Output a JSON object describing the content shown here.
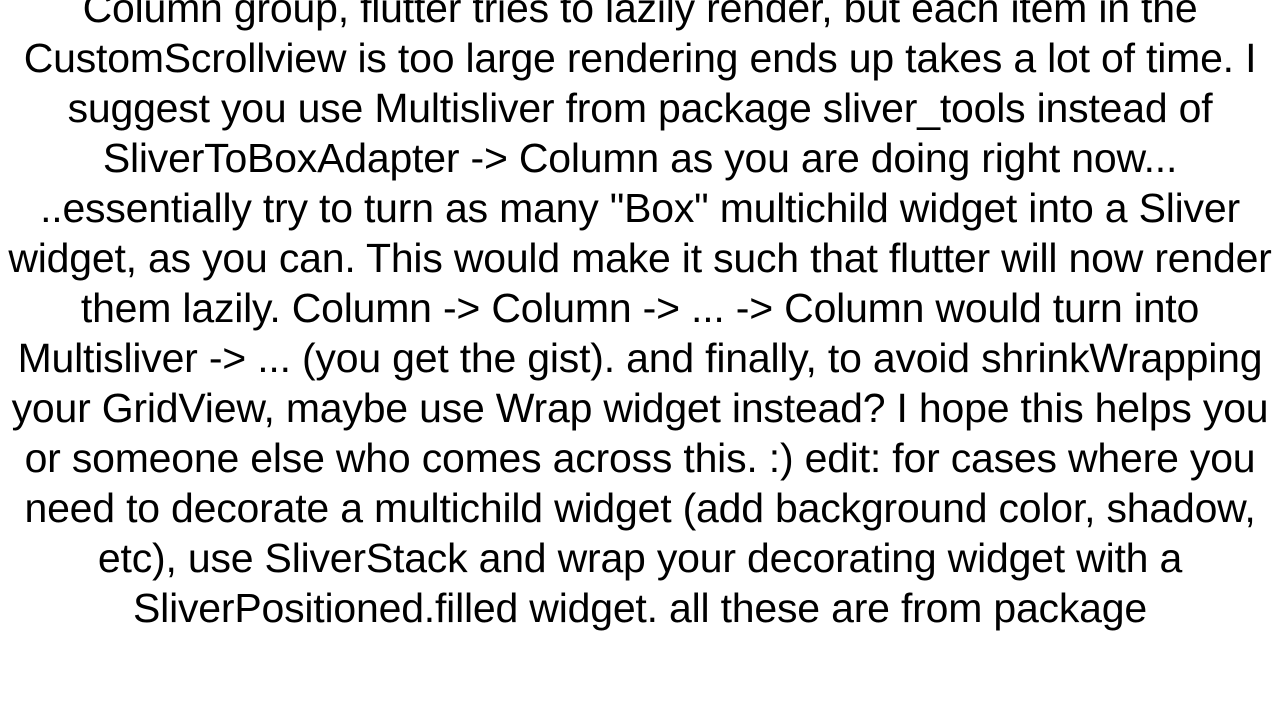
{
  "content": {
    "body_text": "Column group, flutter tries to lazily render, but each item in the CustomScrollview is too large rendering ends up takes a lot of time. I suggest you use Multisliver from package sliver_tools instead of SliverToBoxAdapter -> Column as you are doing right now... ..essentially try to turn as many \"Box\" multichild widget into a Sliver widget, as you can. This would make it such that flutter will now render them lazily. Column -> Column -> ... -> Column would turn into Multisliver -> ... (you get the gist). and finally, to avoid shrinkWrapping your GridView, maybe use Wrap widget instead? I hope this helps you or someone else who comes across this. :) edit: for cases where you need to decorate a multichild widget (add background color, shadow, etc), use SliverStack and wrap your decorating widget with a SliverPositioned.filled widget. all these are from package"
  }
}
